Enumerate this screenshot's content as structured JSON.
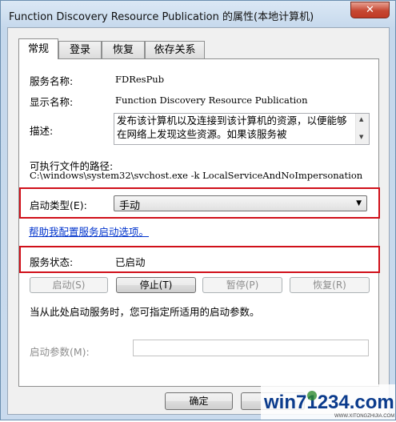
{
  "window": {
    "title": "Function Discovery Resource Publication 的属性(本地计算机)",
    "close": "✕"
  },
  "tabs": [
    {
      "label": "常规"
    },
    {
      "label": "登录"
    },
    {
      "label": "恢复"
    },
    {
      "label": "依存关系"
    }
  ],
  "general": {
    "service_name_label": "服务名称:",
    "service_name": "FDResPub",
    "display_name_label": "显示名称:",
    "display_name": "Function Discovery Resource Publication",
    "description_label": "描述:",
    "description": "发布该计算机以及连接到该计算机的资源，以便能够在网络上发现这些资源。如果该服务被",
    "exe_path_label": "可执行文件的路径:",
    "exe_path": "C:\\windows\\system32\\svchost.exe -k LocalServiceAndNoImpersonation",
    "startup_type_label": "启动类型(E):",
    "startup_type_value": "手动",
    "help_link": "帮助我配置服务启动选项。",
    "status_label": "服务状态:",
    "status_value": "已启动",
    "start_button": "启动(S)",
    "stop_button": "停止(T)",
    "pause_button": "暂停(P)",
    "resume_button": "恢复(R)",
    "hint_text": "当从此处启动服务时，您可指定所适用的启动参数。",
    "start_params_label": "启动参数(M):"
  },
  "footer": {
    "ok_button": "确定"
  },
  "watermark": {
    "text": "win71234.com",
    "small": "WWW.XITONGZHIJIA.COM"
  },
  "colors": {
    "highlight_box": "#d0101a",
    "link": "#0033cc",
    "title_bar": "#c5d8ec",
    "close_button": "#c64732"
  }
}
